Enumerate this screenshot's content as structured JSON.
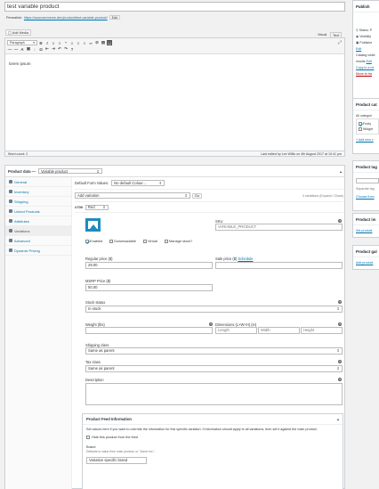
{
  "post": {
    "title": "test variable product",
    "permalink_label": "Permalink:",
    "permalink_url": "https://woocommerce.dev/product/test-variable-product/",
    "edit_label": "Edit"
  },
  "editor": {
    "add_media": "Add Media",
    "tab_visual": "Visual",
    "tab_text": "Text",
    "format_select": "Paragraph",
    "content": "lorem ipsum",
    "word_count": "Word count: 2",
    "last_edited": "Last edited by Lee Willis on 4th August 2017 at 10:41 pm"
  },
  "product_data": {
    "label": "Product data —",
    "type": "Variable product",
    "tabs": [
      {
        "label": "General"
      },
      {
        "label": "Inventory"
      },
      {
        "label": "Shipping"
      },
      {
        "label": "Linked Products"
      },
      {
        "label": "Attributes"
      },
      {
        "label": "Variations"
      },
      {
        "label": "Advanced"
      },
      {
        "label": "Dynamic Pricing"
      }
    ],
    "default_form_label": "Default Form Values:",
    "default_colour": "No default Colour...",
    "add_variation": "Add variation",
    "go": "Go",
    "variation_count": "4 variations (Expand / Close)",
    "variation_id": "#709",
    "variation_attr": "Red",
    "sku_label": "SKU",
    "sku_placeholder": "VARIABLE_PRODUCT",
    "enabled": "Enabled",
    "downloadable": "Downloadable",
    "virtual": "Virtual",
    "manage_stock": "Manage stock?",
    "regular_price_label": "Regular price ($)",
    "regular_price": "29.00",
    "sale_price_label": "Sale price ($)",
    "schedule": "Schedule",
    "msrp_label": "MSRP Price ($)",
    "msrp": "50.00",
    "stock_status_label": "Stock status",
    "stock_status": "In stock",
    "weight_label": "Weight (lbs)",
    "dimensions_label": "Dimensions (L×W×H) (in)",
    "length": "Length",
    "width": "Width",
    "height": "Height",
    "shipping_class_label": "Shipping class",
    "shipping_class": "Same as parent",
    "tax_class_label": "Tax class",
    "tax_class": "Same as parent",
    "description_label": "Description"
  },
  "feed": {
    "title": "Product Feed Information",
    "intro": "Set values here if you want to override the information for this specific variation. If information should apply to all variations, then set it against the main product.",
    "hide_label": "Hide this product from the feed",
    "brand_label": "Brand",
    "brand_help": "Defaults to value from main product, or \"Acme Inc.\".",
    "brand_value": "Variation specific brand"
  },
  "sidebar": {
    "publish_title": "Publish",
    "status": "Status: P",
    "visibility": "Visibility",
    "published": "Publishe",
    "edit": "Edit",
    "catalog": "Catalog visibi",
    "results": "results",
    "copy": "Copy to a ne",
    "trash": "Move to tra",
    "cats_title": "Product cat",
    "all_cats": "All categori",
    "fruity": "Fruity",
    "widget": "Widget",
    "add_new": "+ Add new c",
    "tags_title": "Product tag",
    "separate": "Separate tag",
    "choose": "Choose from",
    "image_title": "Product im",
    "set_image": "Set product",
    "gallery_title": "Product gal",
    "add_gallery": "Add product"
  }
}
